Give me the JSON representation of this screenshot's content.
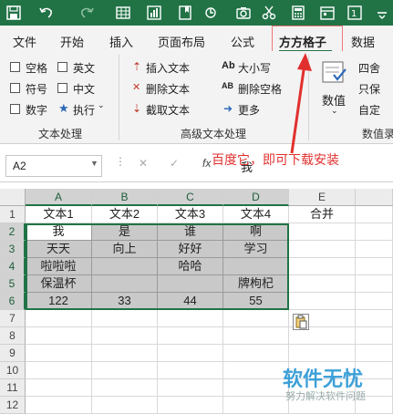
{
  "qat": {
    "icons": [
      "save-icon",
      "undo-icon",
      "redo-icon",
      "table-icon",
      "chart-icon",
      "bookmark-icon",
      "more-icon",
      "camera-icon",
      "cut-icon",
      "calc-icon",
      "calendar-icon",
      "number-icon",
      "overflow-icon"
    ]
  },
  "tabs": [
    "文件",
    "开始",
    "插入",
    "页面布局",
    "公式",
    "方方格子",
    "数据"
  ],
  "ribbon": {
    "text_group": {
      "checkboxes": [
        {
          "label": "空格"
        },
        {
          "label": "英文"
        },
        {
          "label": "符号"
        },
        {
          "label": "中文"
        },
        {
          "label": "数字"
        }
      ],
      "execute_label": "执行",
      "group_label": "文本处理"
    },
    "adv_group": {
      "items": [
        "插入文本",
        "删除文本",
        "截取文本",
        "大小写",
        "删除空格",
        "更多"
      ],
      "group_label": "高级文本处理"
    },
    "value_group": {
      "big_label": "数值",
      "items": [
        "四舍",
        "只保",
        "自定"
      ],
      "group_label": "数值录"
    }
  },
  "formula_bar": {
    "name_box": "A2",
    "content": "我",
    "cancel_symbol": "✕",
    "confirm_symbol": "✓",
    "fx_symbol": "fx"
  },
  "annotation": "百度它，即可下载安装",
  "sheet": {
    "columns": [
      "A",
      "B",
      "C",
      "D",
      "E"
    ],
    "rows": [
      "1",
      "2",
      "3",
      "4",
      "5",
      "6",
      "7",
      "8",
      "9",
      "10",
      "11",
      "12"
    ],
    "cells": [
      [
        "文本1",
        "文本2",
        "文本3",
        "文本4",
        "合并"
      ],
      [
        "我",
        "是",
        "谁",
        "啊",
        ""
      ],
      [
        "天天",
        "向上",
        "好好",
        "学习",
        ""
      ],
      [
        "啦啦啦",
        "",
        "哈哈",
        "",
        ""
      ],
      [
        "保温杯",
        "",
        "",
        "牌枸杞",
        ""
      ],
      [
        "122",
        "33",
        "44",
        "55",
        ""
      ]
    ]
  },
  "watermark": {
    "title": "软件无忧",
    "subtitle": "努力解决软件问题"
  },
  "colors": {
    "excel_green": "#217346",
    "annotation_red": "#e0302e",
    "selected_fill": "#c9c9c9"
  }
}
